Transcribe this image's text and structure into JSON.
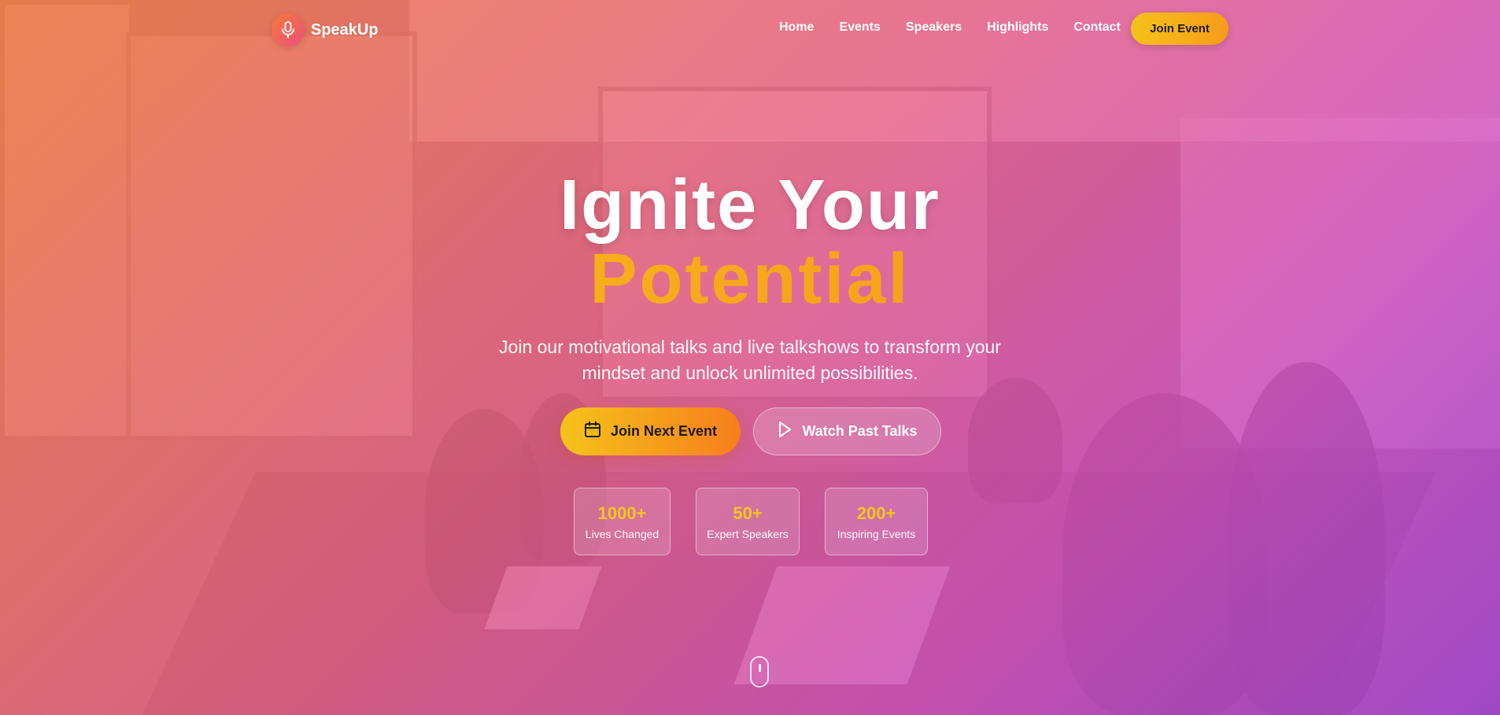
{
  "brand": {
    "name": "SpeakUp",
    "icon": "microphone-icon"
  },
  "nav": {
    "items": [
      "Home",
      "Events",
      "Speakers",
      "Highlights",
      "Contact"
    ],
    "cta_label": "Join Event"
  },
  "hero": {
    "title_line1": "Ignite Your",
    "title_line2": "Potential",
    "subtitle_line1": "Join our motivational talks and live talkshows to transform your",
    "subtitle_line2": "mindset and unlock unlimited possibilities.",
    "primary_cta": {
      "label": "Join Next Event",
      "icon": "calendar-icon"
    },
    "secondary_cta": {
      "label": "Watch Past Talks",
      "icon": "play-icon"
    }
  },
  "stats": [
    {
      "value": "1000+",
      "label": "Lives Changed"
    },
    {
      "value": "50+",
      "label": "Expert Speakers"
    },
    {
      "value": "200+",
      "label": "Inspiring Events"
    }
  ],
  "scroll_indicator": "mouse-scroll-icon",
  "colors": {
    "accent_yellow": "#f7c51b",
    "accent_orange": "#f77e1c",
    "overlay_start": "#fa8246",
    "overlay_end": "#a546d2"
  }
}
